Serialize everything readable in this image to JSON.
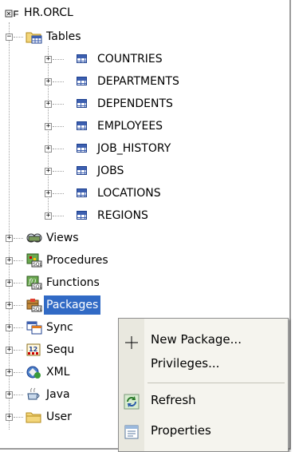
{
  "tree": {
    "connection": "HR.ORCL",
    "tables_label": "Tables",
    "tables": [
      "COUNTRIES",
      "DEPARTMENTS",
      "DEPENDENTS",
      "EMPLOYEES",
      "JOB_HISTORY",
      "JOBS",
      "LOCATIONS",
      "REGIONS"
    ],
    "nodes": [
      "Views",
      "Procedures",
      "Functions",
      "Packages",
      "Synonyms",
      "Sequences",
      "XML",
      "Java",
      "Users"
    ],
    "nodes_visible": [
      "Views",
      "Procedures",
      "Functions",
      "Packages",
      "Sync",
      "Sequ",
      "XML",
      "Java",
      "User"
    ]
  },
  "context_menu": {
    "items": [
      "New Package...",
      "Privileges...",
      "Refresh",
      "Properties"
    ]
  },
  "colors": {
    "selection": "#316ac5",
    "menu_bg": "#f5f4ee"
  }
}
